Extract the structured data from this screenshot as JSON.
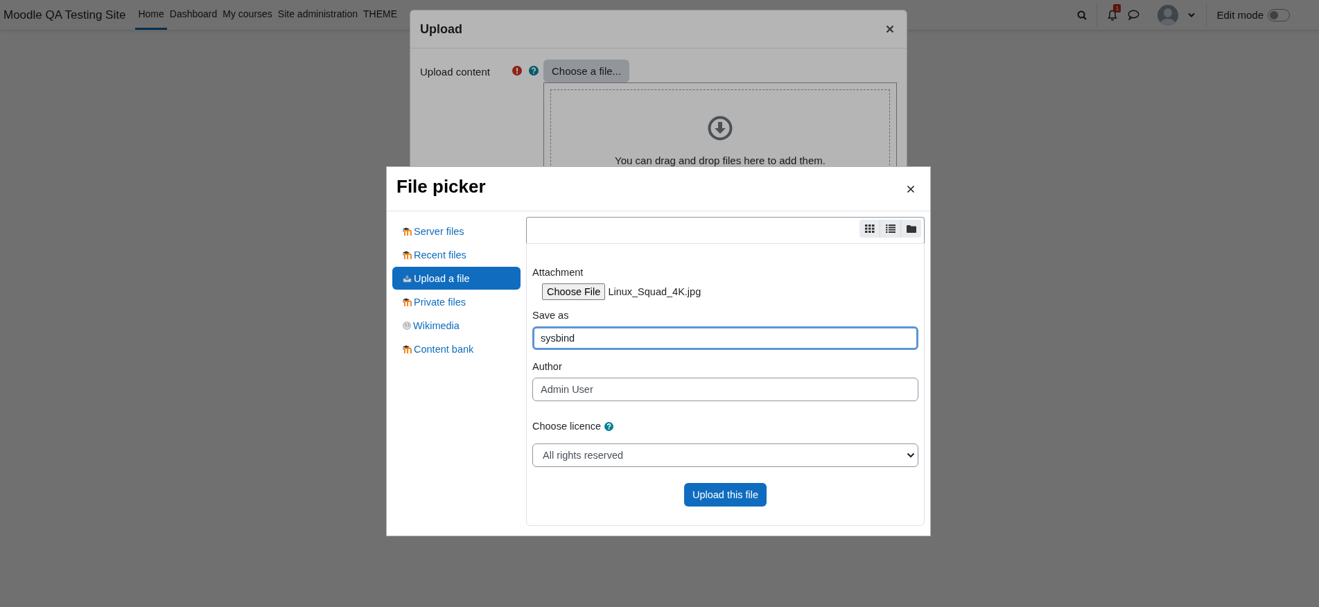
{
  "site_name": "Moodle QA Testing Site",
  "nav": [
    {
      "label": "Home",
      "selected": true
    },
    {
      "label": "Dashboard",
      "selected": false
    },
    {
      "label": "My courses",
      "selected": false
    },
    {
      "label": "Site administration",
      "selected": false
    },
    {
      "label": "THEME",
      "selected": false
    }
  ],
  "notification_count": "1",
  "edit_mode": {
    "label": "Edit mode",
    "on": false
  },
  "upload_dialog": {
    "title": "Upload",
    "field_label": "Upload content",
    "choose_button": "Choose a file...",
    "drop_hint": "You can drag and drop files here to add them."
  },
  "file_picker": {
    "title": "File picker",
    "repositories": [
      {
        "label": "Server files",
        "kind": "moodle",
        "selected": false
      },
      {
        "label": "Recent files",
        "kind": "moodle",
        "selected": false
      },
      {
        "label": "Upload a file",
        "kind": "upload",
        "selected": true
      },
      {
        "label": "Private files",
        "kind": "moodle",
        "selected": false
      },
      {
        "label": "Wikimedia",
        "kind": "globe",
        "selected": false
      },
      {
        "label": "Content bank",
        "kind": "moodle",
        "selected": false
      }
    ],
    "attachment": {
      "label": "Attachment",
      "button": "Choose File",
      "file_name": "Linux_Squad_4K.jpg"
    },
    "save_as": {
      "label": "Save as",
      "value": "sysbind"
    },
    "author": {
      "label": "Author",
      "value": "Admin User"
    },
    "licence": {
      "label": "Choose licence",
      "value": "All rights reserved"
    },
    "submit": "Upload this file"
  }
}
